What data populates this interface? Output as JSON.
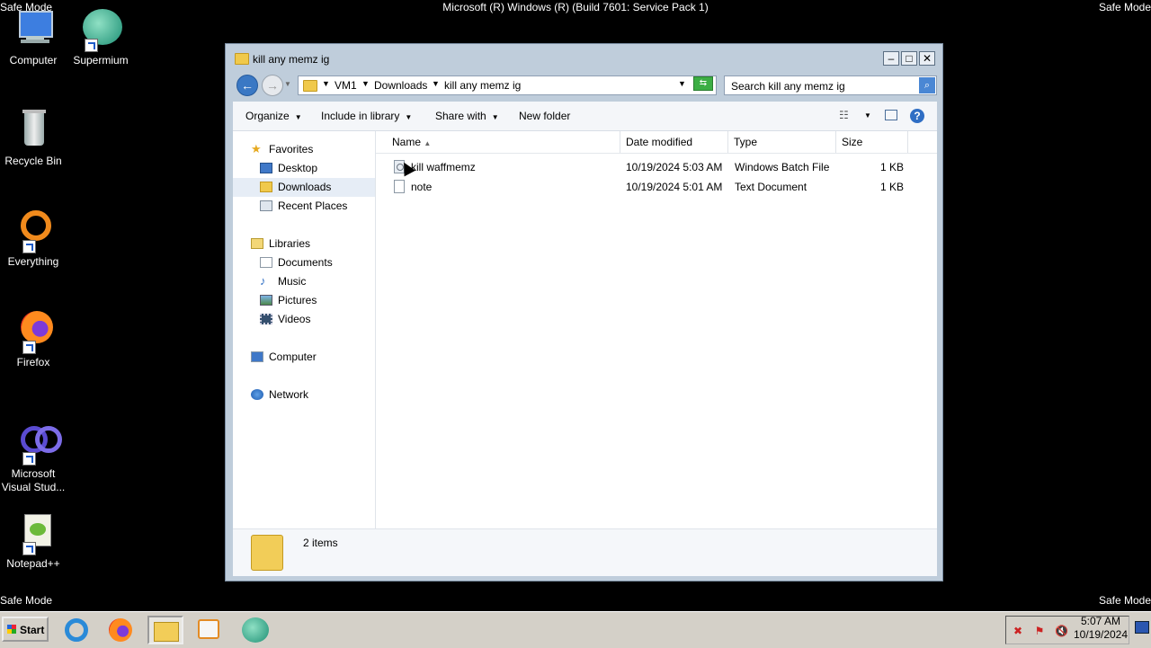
{
  "screen": {
    "safe_mode_label": "Safe Mode",
    "os_title": "Microsoft (R) Windows (R) (Build 7601: Service Pack 1)"
  },
  "desktop_icons": [
    {
      "label": "Computer",
      "icon": "computer-icon"
    },
    {
      "label": "Supermium",
      "icon": "supermium-icon"
    },
    {
      "label": "Recycle Bin",
      "icon": "recycle-bin-icon"
    },
    {
      "label": "Everything",
      "icon": "everything-icon"
    },
    {
      "label": "Firefox",
      "icon": "firefox-icon"
    },
    {
      "label": "Microsoft Visual Stud...",
      "icon": "visual-studio-icon"
    },
    {
      "label": "Notepad++",
      "icon": "notepad-plus-plus-icon"
    }
  ],
  "window": {
    "title": "kill any memz ig",
    "address": {
      "segments": [
        "VM1",
        "Downloads",
        "kill any memz ig"
      ]
    },
    "search_placeholder": "Search kill any memz ig",
    "toolbar": {
      "organize": "Organize",
      "include_in_library": "Include in library",
      "share_with": "Share with",
      "new_folder": "New folder"
    },
    "nav": {
      "favorites": "Favorites",
      "desktop": "Desktop",
      "downloads": "Downloads",
      "recent_places": "Recent Places",
      "libraries": "Libraries",
      "documents": "Documents",
      "music": "Music",
      "pictures": "Pictures",
      "videos": "Videos",
      "computer": "Computer",
      "network": "Network"
    },
    "columns": {
      "name": "Name",
      "date_modified": "Date modified",
      "type": "Type",
      "size": "Size"
    },
    "files": [
      {
        "name": "kill waffmemz",
        "date": "10/19/2024 5:03 AM",
        "type": "Windows Batch File",
        "size": "1 KB"
      },
      {
        "name": "note",
        "date": "10/19/2024 5:01 AM",
        "type": "Text Document",
        "size": "1 KB"
      }
    ],
    "item_count": "2 items"
  },
  "taskbar": {
    "start_label": "Start",
    "clock_time": "5:07 AM",
    "clock_date": "10/19/2024"
  },
  "colors": {
    "accent": "#3a78c4",
    "desktop_bg": "#000000",
    "taskbar_bg": "#d4d0c8"
  }
}
